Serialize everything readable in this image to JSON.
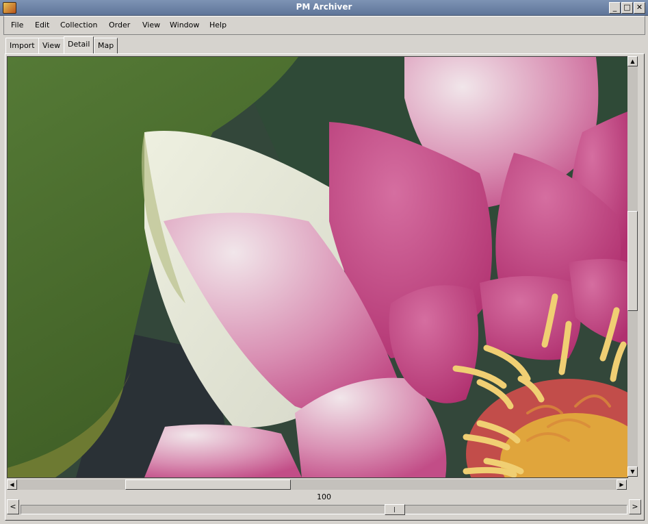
{
  "window": {
    "title": "PM Archiver",
    "minimize_glyph": "_",
    "maximize_glyph": "□",
    "close_glyph": "✕"
  },
  "menu": [
    "File",
    "Edit",
    "Collection",
    "Order",
    "View",
    "Window",
    "Help"
  ],
  "tabs": [
    "Import",
    "View",
    "Detail",
    "Map"
  ],
  "active_tab": "Detail",
  "photo": {
    "subject": "pink water lily close-up",
    "colors": {
      "leaf": "#4d6b2e",
      "petal": "#c9558f",
      "petal_light": "#e9d8e0",
      "stamen": "#e9c15a"
    }
  },
  "scroll": {
    "horizontal_position": 0.19,
    "vertical_position": 0.37
  },
  "zoom": {
    "value": "100",
    "left_glyph": "<",
    "right_glyph": ">",
    "slider_position": 0.62
  },
  "scroll_glyphs": {
    "up": "▲",
    "down": "▼",
    "left": "◀",
    "right": "▶"
  }
}
